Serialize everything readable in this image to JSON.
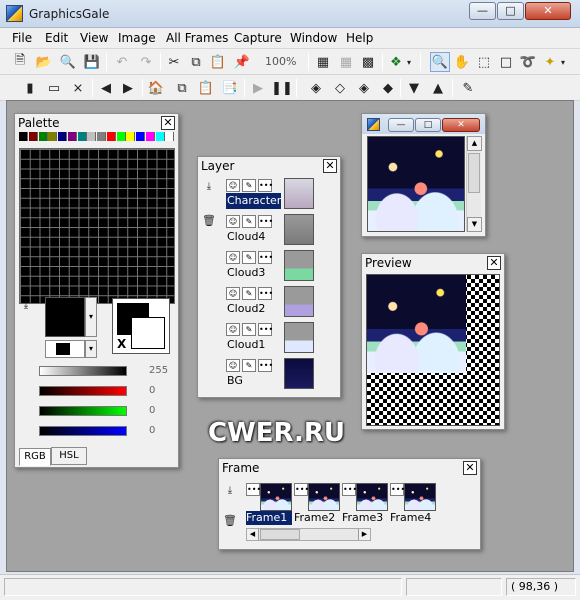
{
  "window": {
    "title": "GraphicsGale"
  },
  "menu": [
    "File",
    "Edit",
    "View",
    "Image",
    "All Frames",
    "Capture",
    "Window",
    "Help"
  ],
  "toolbar": {
    "zoom": "100%"
  },
  "palette": {
    "title": "Palette",
    "top_swatches": [
      "#000000",
      "#7f0000",
      "#007f00",
      "#7f7f00",
      "#00007f",
      "#7f007f",
      "#007f7f",
      "#c0c0c0",
      "#7f7f7f",
      "#ff0000",
      "#00ff00",
      "#ffff00",
      "#0000ff",
      "#ff00ff",
      "#00ffff",
      "#ffffff"
    ],
    "gray_value": "255",
    "red_value": "0",
    "green_value": "0",
    "blue_value": "0",
    "swap_label": "X",
    "tabs": [
      "RGB",
      "HSL"
    ]
  },
  "layer": {
    "title": "Layer",
    "layers": [
      {
        "name": "Character",
        "selected": true
      },
      {
        "name": "Cloud4",
        "selected": false
      },
      {
        "name": "Cloud3",
        "selected": false
      },
      {
        "name": "Cloud2",
        "selected": false
      },
      {
        "name": "Cloud1",
        "selected": false
      },
      {
        "name": "BG",
        "selected": false
      }
    ]
  },
  "preview": {
    "title": "Preview"
  },
  "frame": {
    "title": "Frame",
    "frames": [
      "Frame1",
      "Frame2",
      "Frame3",
      "Frame4"
    ],
    "selected_index": 0
  },
  "watermark": "CWER.RU",
  "status": {
    "coords": "( 98,36 )"
  }
}
